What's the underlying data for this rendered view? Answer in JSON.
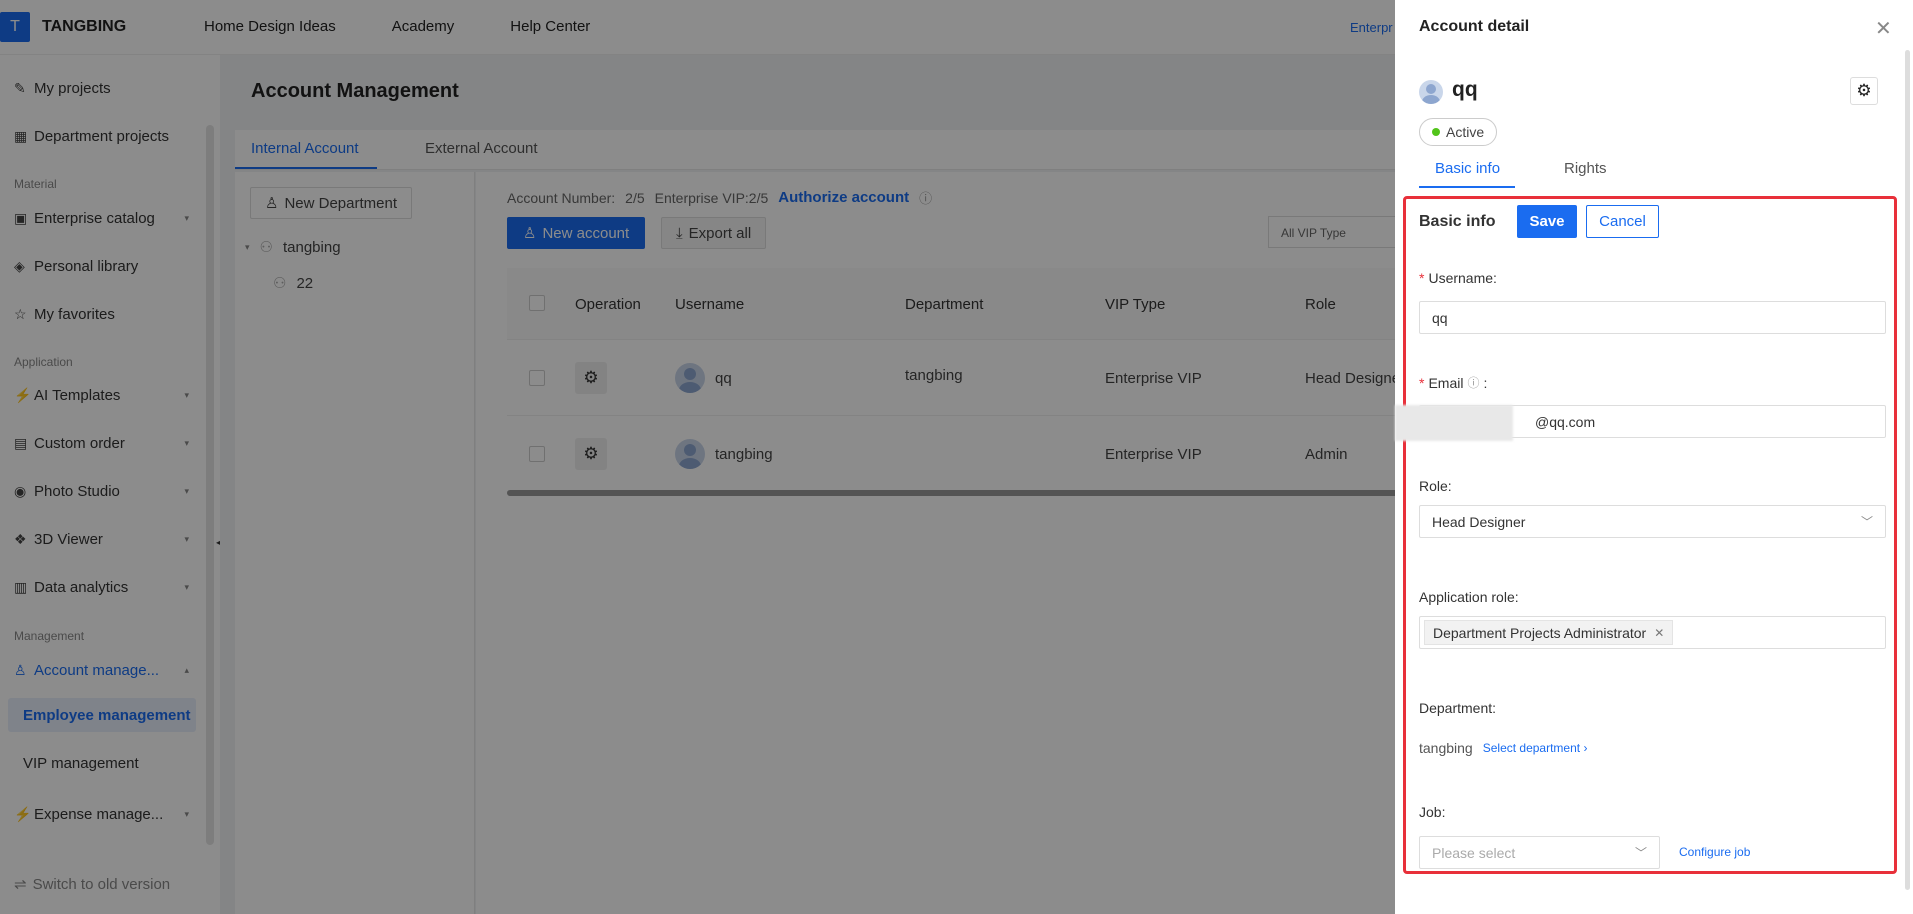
{
  "header": {
    "logo_letter": "T",
    "brand": "TANGBING",
    "nav": [
      "Home Design Ideas",
      "Academy",
      "Help Center"
    ],
    "enterprise_label": "Enterpr"
  },
  "sidebar": {
    "items": [
      {
        "label": "My projects",
        "icon": "projects-icon"
      },
      {
        "label": "Department projects",
        "icon": "department-icon"
      }
    ],
    "group_material": "Material",
    "material_items": [
      {
        "label": "Enterprise catalog",
        "icon": "catalog-icon"
      },
      {
        "label": "Personal library",
        "icon": "library-icon"
      },
      {
        "label": "My favorites",
        "icon": "star-icon"
      }
    ],
    "group_application": "Application",
    "application_items": [
      {
        "label": "AI Templates",
        "icon": "ai-icon"
      },
      {
        "label": "Custom order",
        "icon": "order-icon"
      },
      {
        "label": "Photo Studio",
        "icon": "camera-icon"
      },
      {
        "label": "3D Viewer",
        "icon": "viewer-icon"
      },
      {
        "label": "Data analytics",
        "icon": "chart-icon"
      }
    ],
    "group_management": "Management",
    "account_management": "Account manage...",
    "sub_items": [
      "Employee management",
      "VIP management"
    ],
    "expense": "Expense manage...",
    "switch_old": "Switch to old version"
  },
  "main": {
    "title": "Account Management",
    "tabs": [
      "Internal Account",
      "External Account"
    ],
    "new_department": "New Department",
    "tree": [
      "tangbing",
      "22"
    ],
    "account_number_label": "Account Number:",
    "account_number": "2/5",
    "enterprise_vip": "Enterprise VIP:2/5",
    "authorize": "Authorize account",
    "new_account": "New account",
    "export_all": "Export all",
    "vip_filter": "All VIP Type",
    "columns": [
      "Operation",
      "Username",
      "Department",
      "VIP Type",
      "Role"
    ],
    "rows": [
      {
        "username": "qq",
        "department": "tangbing",
        "vip": "Enterprise VIP",
        "role": "Head Designe"
      },
      {
        "username": "tangbing",
        "department": "",
        "vip": "Enterprise VIP",
        "role": "Admin"
      }
    ]
  },
  "drawer": {
    "title": "Account detail",
    "name": "qq",
    "status": "Active",
    "tabs": [
      "Basic info",
      "Rights"
    ],
    "form_title": "Basic info",
    "save": "Save",
    "cancel": "Cancel",
    "username_label": "Username:",
    "username_value": "qq",
    "email_label": "Email",
    "email_suffix": "@qq.com",
    "role_label": "Role:",
    "role_value": "Head Designer",
    "app_role_label": "Application role:",
    "app_role_tag": "Department Projects Administrator",
    "department_label": "Department:",
    "department_value": "tangbing",
    "select_department": "Select department",
    "job_label": "Job:",
    "job_placeholder": "Please select",
    "configure_job": "Configure job"
  },
  "colors": {
    "accent": "#1a6cf0",
    "highlight": "#e8303a",
    "active_dot": "#52c41a"
  }
}
